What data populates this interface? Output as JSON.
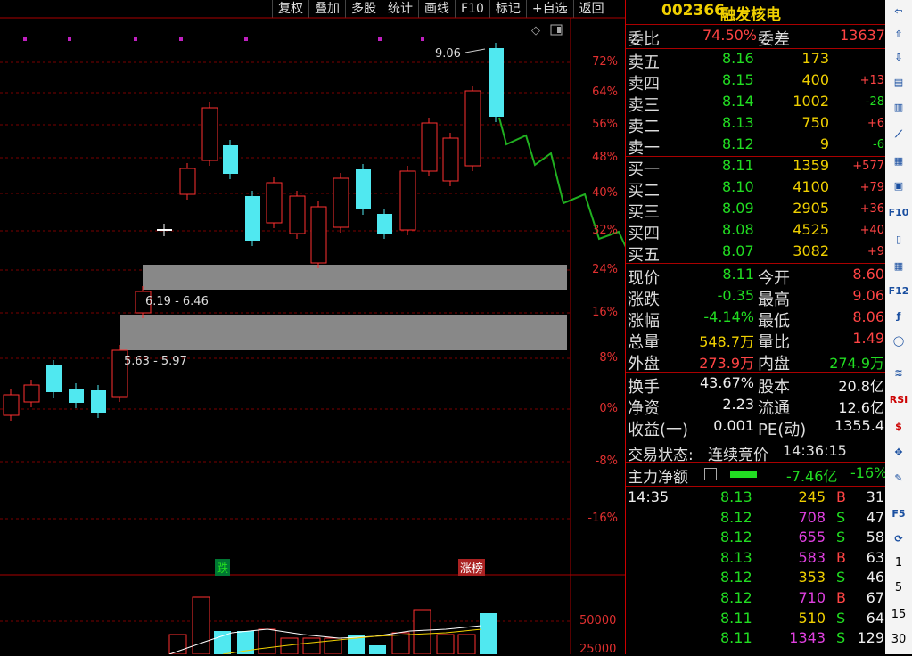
{
  "menu": [
    "复权",
    "叠加",
    "多股",
    "统计",
    "画线",
    "F10",
    "标记",
    "+自选",
    "返回"
  ],
  "stock": {
    "code": "002366",
    "name": "融发核电"
  },
  "chart_data": {
    "type": "candlestick",
    "price_axis_labels": [
      "72%",
      "64%",
      "56%",
      "48%",
      "40%",
      "32%",
      "24%",
      "16%",
      "8%",
      "0%",
      "-8%",
      "-16%"
    ],
    "high_marker": "9.06",
    "gaps": [
      "6.19 - 6.46",
      "5.63 - 5.97"
    ],
    "tags": {
      "fall": "跌",
      "limit": "涨榜"
    },
    "volume_axis_labels": [
      "50000",
      "25000"
    ]
  },
  "quote": {
    "weibi_label": "委比",
    "weibi": "74.50%",
    "weicha_label": "委差",
    "weicha": "13637",
    "asks": [
      {
        "label": "卖五",
        "price": "8.16",
        "vol": "173",
        "chg": ""
      },
      {
        "label": "卖四",
        "price": "8.15",
        "vol": "400",
        "chg": "+13"
      },
      {
        "label": "卖三",
        "price": "8.14",
        "vol": "1002",
        "chg": "-28"
      },
      {
        "label": "卖二",
        "price": "8.13",
        "vol": "750",
        "chg": "+6"
      },
      {
        "label": "卖一",
        "price": "8.12",
        "vol": "9",
        "chg": "-6"
      }
    ],
    "bids": [
      {
        "label": "买一",
        "price": "8.11",
        "vol": "1359",
        "chg": "+577"
      },
      {
        "label": "买二",
        "price": "8.10",
        "vol": "4100",
        "chg": "+79"
      },
      {
        "label": "买三",
        "price": "8.09",
        "vol": "2905",
        "chg": "+36"
      },
      {
        "label": "买四",
        "price": "8.08",
        "vol": "4525",
        "chg": "+40"
      },
      {
        "label": "买五",
        "price": "8.07",
        "vol": "3082",
        "chg": "+9"
      }
    ],
    "stats": [
      {
        "l1": "现价",
        "v1": "8.11",
        "l2": "今开",
        "v2": "8.60"
      },
      {
        "l1": "涨跌",
        "v1": "-0.35",
        "l2": "最高",
        "v2": "9.06"
      },
      {
        "l1": "涨幅",
        "v1": "-4.14%",
        "l2": "最低",
        "v2": "8.06"
      },
      {
        "l1": "总量",
        "v1": "548.7万",
        "l2": "量比",
        "v2": "1.49"
      },
      {
        "l1": "外盘",
        "v1": "273.9万",
        "l2": "内盘",
        "v2": "274.9万"
      }
    ],
    "stats2": [
      {
        "l1": "换手",
        "v1": "43.67%",
        "l2": "股本",
        "v2": "20.8亿"
      },
      {
        "l1": "净资",
        "v1": "2.23",
        "l2": "流通",
        "v2": "12.6亿"
      },
      {
        "l1": "收益(一)",
        "v1": "0.001",
        "l2": "PE(动)",
        "v2": "1355.4"
      }
    ],
    "status_label": "交易状态:",
    "status": "连续竞价",
    "time": "14:36:15",
    "main_flow_label": "主力净额",
    "main_flow": "-7.46亿",
    "main_flow_pct": "-16%"
  },
  "ticks": [
    {
      "time": "14:35",
      "price": "8.13",
      "vol": "245",
      "bs": "B",
      "n": "31"
    },
    {
      "time": "",
      "price": "8.12",
      "vol": "708",
      "bs": "S",
      "n": "47"
    },
    {
      "time": "",
      "price": "8.12",
      "vol": "655",
      "bs": "S",
      "n": "58"
    },
    {
      "time": "",
      "price": "8.13",
      "vol": "583",
      "bs": "B",
      "n": "63"
    },
    {
      "time": "",
      "price": "8.12",
      "vol": "353",
      "bs": "S",
      "n": "46"
    },
    {
      "time": "",
      "price": "8.12",
      "vol": "710",
      "bs": "B",
      "n": "67"
    },
    {
      "time": "",
      "price": "8.11",
      "vol": "510",
      "bs": "S",
      "n": "64"
    },
    {
      "time": "",
      "price": "8.11",
      "vol": "1343",
      "bs": "S",
      "n": "129"
    }
  ],
  "toolbar_nums": [
    "1",
    "5",
    "15",
    "30"
  ],
  "toolbar_labels": {
    "rsi": "RSI",
    "f10": "F10",
    "f5": "F5"
  }
}
